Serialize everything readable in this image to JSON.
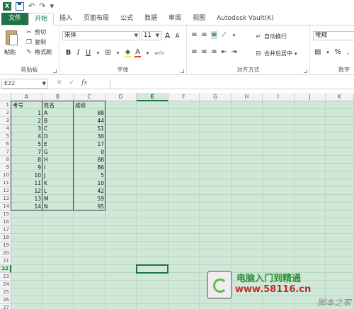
{
  "titlebar": {
    "app_icon": "excel-icon",
    "save_icon": "save-icon",
    "undo_icon": "undo-icon",
    "redo_icon": "redo-icon"
  },
  "tabs": [
    "文件",
    "开始",
    "插入",
    "页面布局",
    "公式",
    "数据",
    "审阅",
    "视图",
    "Autodesk Vault(K)"
  ],
  "active_tab": "开始",
  "ribbon": {
    "clipboard": {
      "paste": "粘贴",
      "cut": "剪切",
      "copy": "复制",
      "format_painter": "格式刷",
      "label": "剪贴板"
    },
    "font": {
      "name": "宋体",
      "size": "11",
      "label": "字体",
      "bold": "B",
      "italic": "I",
      "underline": "U",
      "grow": "A",
      "shrink": "A",
      "font_color": "A",
      "phonetic": "wén"
    },
    "alignment": {
      "wrap": "自动换行",
      "merge": "合并后居中",
      "label": "对齐方式"
    },
    "number": {
      "format": "常规",
      "percent": "%",
      "label": "数字"
    }
  },
  "formula_bar": {
    "name_box": "E22",
    "cancel": "✕",
    "enter": "✓",
    "fx": "fx",
    "formula": ""
  },
  "columns": [
    "A",
    "B",
    "C",
    "D",
    "E",
    "F",
    "G",
    "H",
    "I",
    "J",
    "K"
  ],
  "selected_column": "E",
  "rows": [
    "1",
    "2",
    "3",
    "4",
    "5",
    "6",
    "7",
    "8",
    "9",
    "10",
    "11",
    "12",
    "13",
    "14",
    "15",
    "16",
    "17",
    "18",
    "19",
    "20",
    "21",
    "22",
    "23",
    "24",
    "25",
    "26",
    "27"
  ],
  "selected_row": "22",
  "table": {
    "headers": [
      "考号",
      "姓名",
      "成绩"
    ],
    "rows": [
      [
        "1",
        "A",
        "88"
      ],
      [
        "2",
        "B",
        "44"
      ],
      [
        "3",
        "C",
        "51"
      ],
      [
        "4",
        "D",
        "30"
      ],
      [
        "5",
        "E",
        "17"
      ],
      [
        "7",
        "G",
        "0"
      ],
      [
        "8",
        "H",
        "88"
      ],
      [
        "9",
        "I",
        "86"
      ],
      [
        "10",
        "J",
        "5"
      ],
      [
        "11",
        "K",
        "10"
      ],
      [
        "12",
        "L",
        "42"
      ],
      [
        "13",
        "M",
        "59"
      ],
      [
        "14",
        "N",
        "95"
      ]
    ]
  },
  "watermark": {
    "title": "电脑入门到精通",
    "url": "www.58116.cn",
    "sub": "脚本之家"
  }
}
